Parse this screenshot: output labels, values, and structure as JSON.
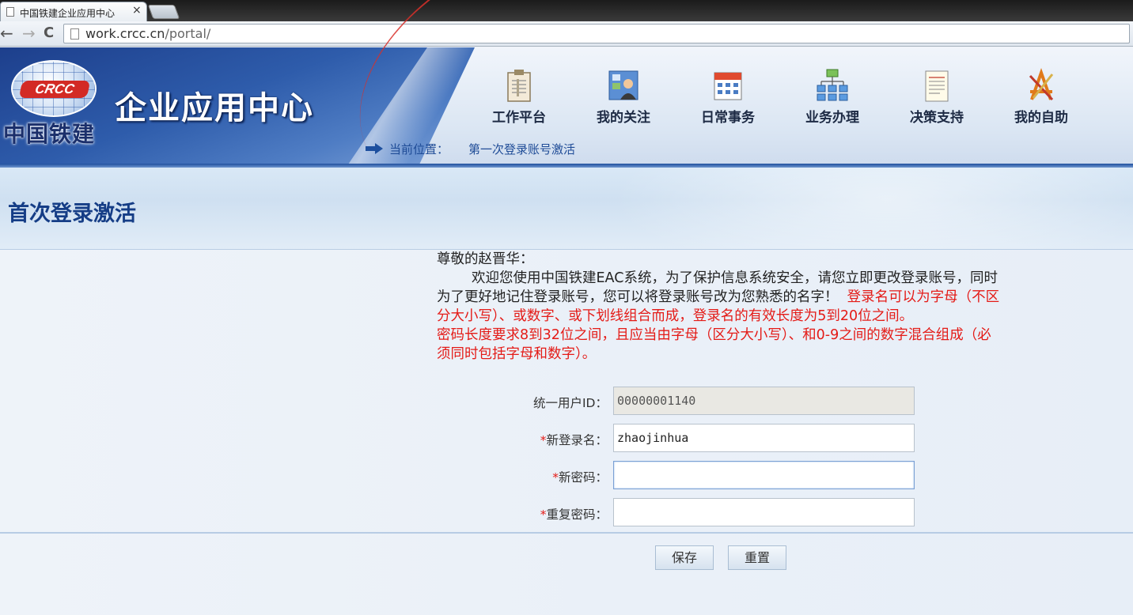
{
  "browser": {
    "tab_title": "中国铁建企业应用中心",
    "tab_close": "×",
    "url_host": "work.crcc.cn",
    "url_path": "/portal/",
    "back": "←",
    "forward": "→",
    "reload": "C"
  },
  "header": {
    "logo_mark": "CRCC",
    "logo_text": "中国铁建",
    "portal_title": "企业应用中心",
    "nav": [
      {
        "label": "工作平台",
        "icon": "clipboard-icon"
      },
      {
        "label": "我的关注",
        "icon": "user-board-icon"
      },
      {
        "label": "日常事务",
        "icon": "calendar-icon"
      },
      {
        "label": "业务办理",
        "icon": "org-chart-icon"
      },
      {
        "label": "决策支持",
        "icon": "document-icon"
      },
      {
        "label": "我的自助",
        "icon": "tools-icon"
      }
    ],
    "location_label": "当前位置：",
    "location_value": "第一次登录账号激活"
  },
  "page": {
    "title": "首次登录激活"
  },
  "notice": {
    "greeting": "尊敬的赵晋华：",
    "body_black": "欢迎您使用中国铁建EAC系统，为了保护信息系统安全，请您立即更改登录账号，同时为了更好地记住登录账号，您可以将登录账号改为您熟悉的名字！",
    "rule_username": "登录名可以为字母（不区分大小写）、或数字、或下划线组合而成，登录名的有效长度为5到20位之间。",
    "rule_password": "密码长度要求8到32位之间，且应当由字母（区分大小写）、和0-9之间的数字混合组成（必须同时包括字母和数字）。"
  },
  "form": {
    "required_mark": "*",
    "uid_label": "统一用户ID：",
    "uid_value": "00000001140",
    "username_label": "新登录名：",
    "username_value": "zhaojinhua",
    "password_label": "新密码：",
    "password_value": "",
    "confirm_label": "重复密码：",
    "confirm_value": ""
  },
  "buttons": {
    "save": "保存",
    "reset": "重置"
  },
  "colors": {
    "brand_blue": "#1f4c97",
    "warning_red": "#e41b17",
    "logo_red": "#d32a25"
  }
}
